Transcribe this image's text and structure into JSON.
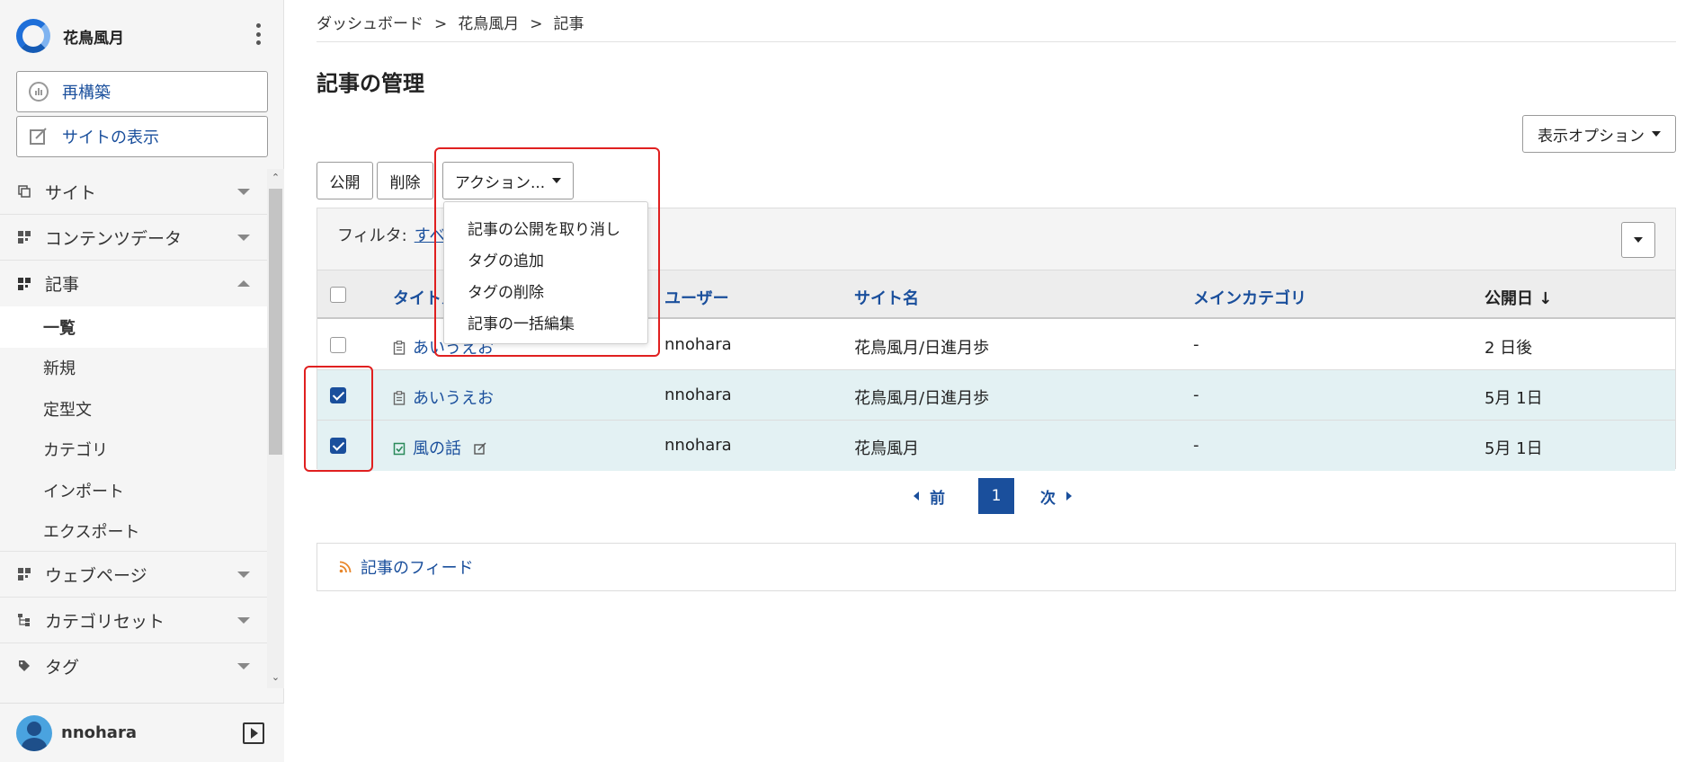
{
  "app": {
    "site_name": "花鳥風月"
  },
  "sidebar": {
    "rebuild_label": "再構築",
    "view_site_label": "サイトの表示",
    "items": [
      {
        "label": "サイト"
      },
      {
        "label": "コンテンツデータ"
      },
      {
        "label": "記事"
      },
      {
        "label": "ウェブページ"
      },
      {
        "label": "カテゴリセット"
      },
      {
        "label": "タグ"
      }
    ],
    "sub_items": [
      {
        "label": "一覧"
      },
      {
        "label": "新規"
      },
      {
        "label": "定型文"
      },
      {
        "label": "カテゴリ"
      },
      {
        "label": "インポート"
      },
      {
        "label": "エクスポート"
      }
    ],
    "user": "nnohara"
  },
  "breadcrumb": [
    "ダッシュボード",
    "花鳥風月",
    "記事"
  ],
  "breadcrumb_sep": ">",
  "page_title": "記事の管理",
  "display_options_label": "表示オプション",
  "toolbar": {
    "publish": "公開",
    "delete": "削除",
    "actions": "アクション..."
  },
  "actions_menu": [
    "記事の公開を取り消し",
    "タグの追加",
    "タグの削除",
    "記事の一括編集"
  ],
  "filter": {
    "label": "フィルタ:",
    "value": "すべ"
  },
  "table": {
    "headers": [
      "タイトル",
      "ユーザー",
      "サイト名",
      "メインカテゴリ",
      "公開日"
    ],
    "sort_arrow": "↓",
    "rows": [
      {
        "checked": false,
        "title": "あいうえお",
        "user": "nnohara",
        "site": "花鳥風月/日進月歩",
        "category": "-",
        "date": "2 日後"
      },
      {
        "checked": true,
        "title": "あいうえお",
        "user": "nnohara",
        "site": "花鳥風月/日進月歩",
        "category": "-",
        "date": "5月 1日"
      },
      {
        "checked": true,
        "title": "風の話",
        "user": "nnohara",
        "site": "花鳥風月",
        "category": "-",
        "date": "5月 1日"
      }
    ]
  },
  "pager": {
    "prev": "前",
    "current": "1",
    "next": "次"
  },
  "feed_label": "記事のフィード",
  "colors": {
    "accent": "#1a4f9c",
    "highlight": "#e02020",
    "selected_row": "#e3f1f3"
  }
}
